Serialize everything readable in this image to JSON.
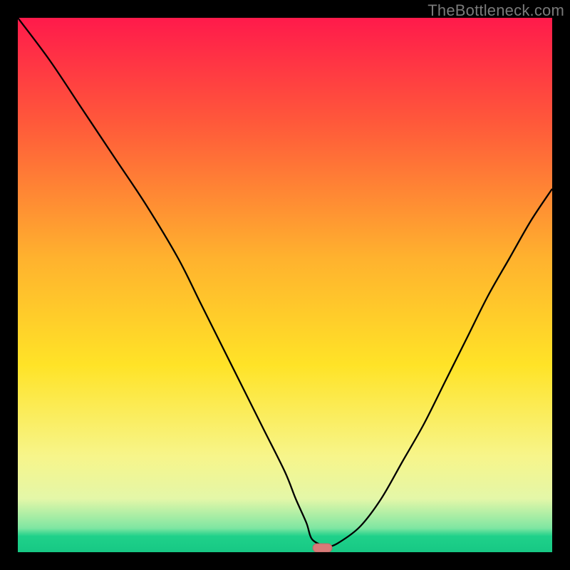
{
  "watermark": "TheBottleneck.com",
  "chart_data": {
    "type": "line",
    "title": "",
    "xlabel": "",
    "ylabel": "",
    "xlim": [
      0,
      100
    ],
    "ylim": [
      0,
      100
    ],
    "grid": false,
    "legend": false,
    "background_gradient_stops": [
      {
        "offset": 0,
        "color": "#ff1a4b"
      },
      {
        "offset": 0.2,
        "color": "#ff5a3a"
      },
      {
        "offset": 0.45,
        "color": "#ffb22e"
      },
      {
        "offset": 0.65,
        "color": "#ffe327"
      },
      {
        "offset": 0.82,
        "color": "#f7f58a"
      },
      {
        "offset": 0.9,
        "color": "#e4f7a8"
      },
      {
        "offset": 0.955,
        "color": "#7ee6a2"
      },
      {
        "offset": 0.97,
        "color": "#1fd18a"
      },
      {
        "offset": 1.0,
        "color": "#17c884"
      }
    ],
    "series": [
      {
        "name": "bottleneck-curve",
        "color": "#000000",
        "stroke_width": 2.3,
        "x": [
          0,
          6,
          12,
          18,
          24,
          30,
          34,
          38,
          42,
          46,
          50,
          52,
          54,
          55,
          57,
          58,
          60,
          64,
          68,
          72,
          76,
          80,
          84,
          88,
          92,
          96,
          100
        ],
        "y": [
          100,
          92,
          83,
          74,
          65,
          55,
          47,
          39,
          31,
          23,
          15,
          10,
          5,
          2,
          1,
          1,
          1,
          4,
          10,
          17,
          24,
          32,
          40,
          48,
          55,
          62,
          68
        ]
      }
    ],
    "marker": {
      "name": "optimal-point-marker",
      "x": 57,
      "y": 0.8,
      "width_pct": 3.6,
      "height_pct": 1.6,
      "fill": "#d97a78",
      "stroke": "#b46a69"
    }
  }
}
